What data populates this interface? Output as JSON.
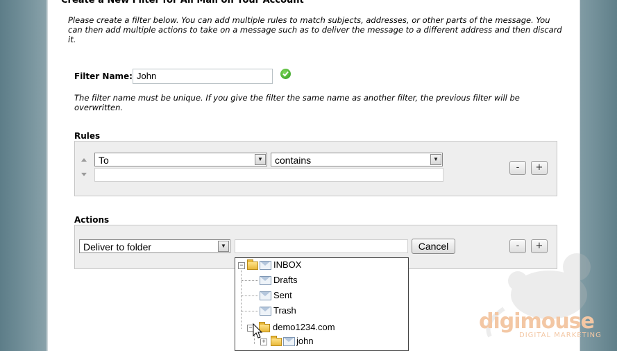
{
  "form": {
    "title": "Create a New Filter for All Mail on Your Account",
    "intro": "Please create a filter below. You can add multiple rules to match subjects, addresses, or other parts of the message. You can then add multiple actions to take on a message such as to deliver the message to a different address and then discard it.",
    "filter_name_label": "Filter Name:",
    "filter_name_value": "John",
    "unique_note": "The filter name must be unique. If you give the filter the same name as another filter, the previous filter will be overwritten."
  },
  "rules": {
    "label": "Rules",
    "field_select": "To",
    "condition_select": "contains",
    "match_value": "",
    "remove_label": "-",
    "add_label": "+"
  },
  "actions": {
    "label": "Actions",
    "action_select": "Deliver to folder",
    "destination_value": "",
    "cancel_label": "Cancel",
    "remove_label": "-",
    "add_label": "+"
  },
  "folder_tree": {
    "items": [
      {
        "label": "INBOX"
      },
      {
        "label": "Drafts"
      },
      {
        "label": "Sent"
      },
      {
        "label": "Trash"
      },
      {
        "label": "demo1234.com"
      },
      {
        "label": "john"
      }
    ]
  },
  "watermark": {
    "brand": "digimouse",
    "tagline": "DIGITAL MARKETING"
  }
}
